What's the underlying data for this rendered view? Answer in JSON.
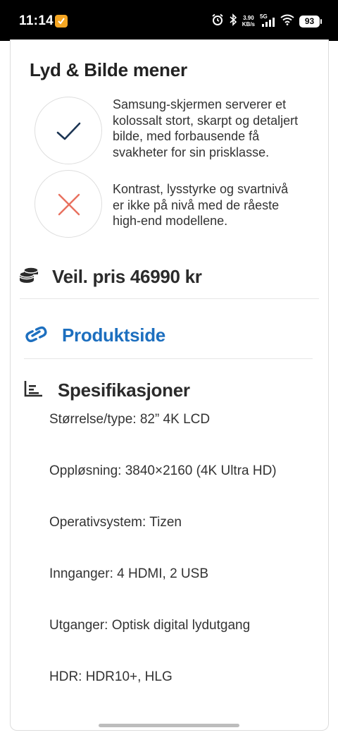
{
  "status_bar": {
    "time": "11:14",
    "network_speed_value": "3.90",
    "network_speed_unit": "KB/s",
    "network_type": "5G",
    "battery": "93",
    "icons": [
      "app-notification-icon",
      "alarm-icon",
      "bluetooth-icon",
      "signal-icon",
      "wifi-icon",
      "battery-icon"
    ]
  },
  "review": {
    "opinion_title": "Lyd & Bilde mener",
    "verdicts": [
      {
        "type": "positive",
        "icon": "check-icon",
        "color": "#1c3553",
        "text": "Samsung-skjermen serverer et kolossalt stort, skarpt og detaljert bilde, med forbausende få svakheter for sin prisklasse."
      },
      {
        "type": "negative",
        "icon": "cross-icon",
        "color": "#e8705e",
        "text": "Kontrast, lysstyrke og svartnivå er ikke på nivå med de råeste high-end modellene."
      }
    ],
    "price_label": "Veil. pris 46990 kr",
    "product_link_label": "Produktside",
    "specs_title": "Spesifikasjoner",
    "specs": [
      "Størrelse/type: 82” 4K LCD",
      "Oppløsning: 3840×2160 (4K Ultra HD)",
      "Operativsystem: Tizen",
      "Innganger: 4 HDMI, 2 USB",
      "Utganger: Optisk digital lydutgang",
      "HDR: HDR10+, HLG"
    ]
  },
  "colors": {
    "link": "#1d6fbf",
    "heading": "#222222",
    "positive": "#1c3553",
    "negative": "#e8705e"
  }
}
